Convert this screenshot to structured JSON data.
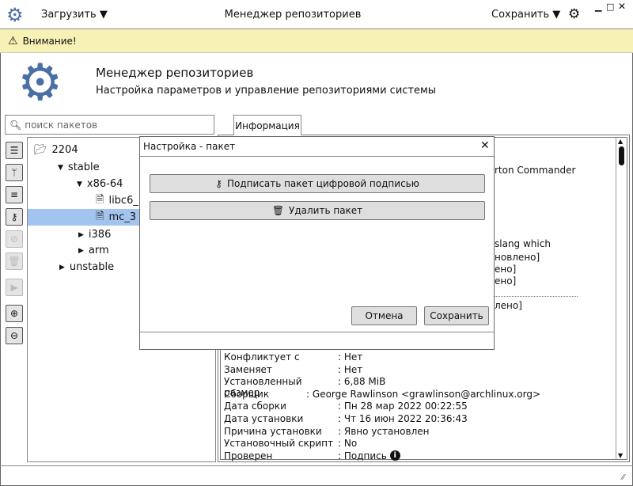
{
  "titlebar": {
    "load_menu": "Загрузить",
    "title": "Менеджер репозиториев",
    "save_menu": "Сохранить"
  },
  "banner": {
    "text": "Внимание!"
  },
  "header": {
    "title": "Менеджер репозиториев",
    "subtitle": "Настройка параметров и управление репозиториями системы"
  },
  "search": {
    "placeholder": "поиск пакетов"
  },
  "tabs": [
    {
      "label": "Информация"
    }
  ],
  "tree": {
    "root": "2204",
    "stable": "stable",
    "x86": "x86-64",
    "pkg1": "libc6_",
    "pkg2": "mc_3",
    "i386": "i386",
    "arm": "arm",
    "unstable": "unstable"
  },
  "info_fragments": [
    "rton Commander",
    "slang  which",
    "новлено]",
    "ено]",
    "ено]",
    "лено]"
  ],
  "info_rows": [
    {
      "k": "Конфликтует с",
      "v": ": Нет"
    },
    {
      "k": "Заменяет",
      "v": ": Нет"
    },
    {
      "k": "Установленный размер",
      "v": ": 6,88 MiB"
    },
    {
      "k": "Сборщик",
      "v": ": George Rawlinson <grawlinson@archlinux.org>"
    },
    {
      "k": "Дата сборки",
      "v": ": Пн 28 мар 2022 00:22:55"
    },
    {
      "k": "Дата установки",
      "v": ": Чт 16 июн 2022 20:36:43"
    },
    {
      "k": "Причина установки",
      "v": ": Явно установлен"
    },
    {
      "k": "Установочный скрипт",
      "v": ": No"
    },
    {
      "k": "Проверен",
      "v": ": Подпись"
    }
  ],
  "dialog": {
    "title": "Настройка - пакет",
    "sign": "Подписать пакет цифровой подписью",
    "delete": "Удалить пакет",
    "cancel": "Отмена",
    "save": "Сохранить"
  },
  "colors": {
    "banner": "#f7f1b6",
    "selection": "#a4c4f0",
    "gear": "#4a6fa5"
  }
}
